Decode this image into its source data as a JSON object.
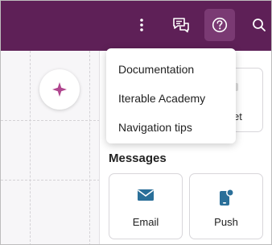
{
  "topbar": {
    "bg_color": "#5e2057",
    "active_bg_color": "#7a3a73",
    "icons": [
      "more-vertical-icon",
      "chat-feedback-icon",
      "help-circle-icon",
      "search-icon"
    ]
  },
  "help_menu": {
    "items": [
      {
        "label": "Documentation"
      },
      {
        "label": "Iterable Academy"
      },
      {
        "label": "Navigation tips"
      }
    ]
  },
  "canvas": {
    "add_icon": "sparkle-icon",
    "sparkle_color": "#b0468f"
  },
  "panel": {
    "partial_card_text": "et",
    "messages_title": "Messages",
    "cards": [
      {
        "label": "Email",
        "icon": "email-icon"
      },
      {
        "label": "Push",
        "icon": "push-notification-icon"
      }
    ],
    "icon_color": "#2a6f99"
  }
}
